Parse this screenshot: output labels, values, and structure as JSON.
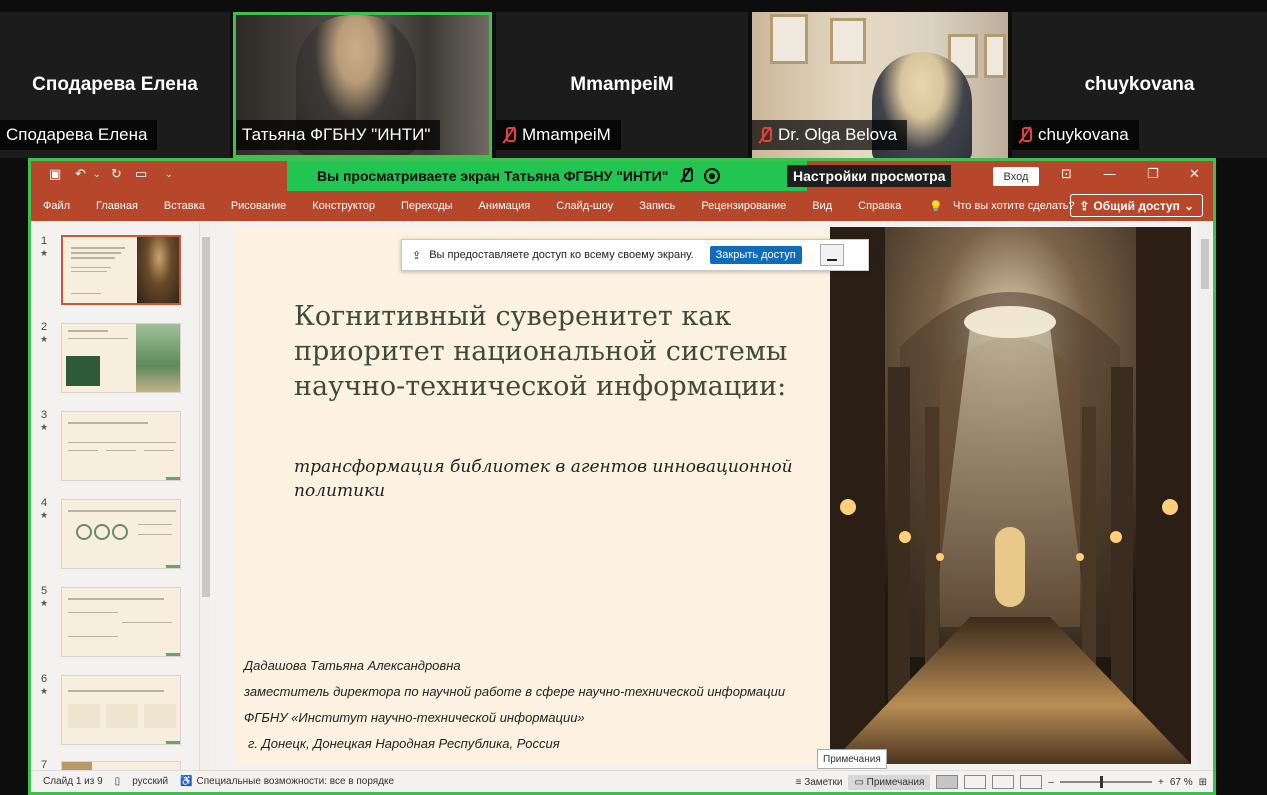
{
  "participants": [
    {
      "name": "Сподарева Елена",
      "label": "Сподарева Елена",
      "muted": false,
      "video": false
    },
    {
      "name": "Татьяна ФГБНУ \"ИНТИ\"",
      "label": "Татьяна ФГБНУ \"ИНТИ\"",
      "muted": false,
      "video": true,
      "active": true
    },
    {
      "name": "MmampeiM",
      "label": "MmampeiM",
      "muted": true,
      "video": false
    },
    {
      "name": "Dr. Olga Belova",
      "label": "Dr. Olga Belova",
      "muted": true,
      "video": true
    },
    {
      "name": "chuykovana",
      "label": "chuykovana",
      "muted": true,
      "video": false
    }
  ],
  "share_banner": {
    "text": "Вы просматриваете экран  Татьяна ФГБНУ \"ИНТИ\"",
    "view_settings": "Настройки просмотра"
  },
  "app": {
    "accent": "#b7472a",
    "login_label": "Вход",
    "ribbon_tabs": [
      "Файл",
      "Главная",
      "Вставка",
      "Рисование",
      "Конструктор",
      "Переходы",
      "Анимация",
      "Слайд-шоу",
      "Запись",
      "Рецензирование",
      "Вид",
      "Справка"
    ],
    "search_placeholder": "Что вы хотите сделать?",
    "share_label": "Общий доступ"
  },
  "sharing_bar": {
    "message": "Вы предоставляете доступ ко всему своему экрану.",
    "close_label": "Закрыть доступ"
  },
  "thumbnails": [
    {
      "num": "1"
    },
    {
      "num": "2"
    },
    {
      "num": "3"
    },
    {
      "num": "4"
    },
    {
      "num": "5"
    },
    {
      "num": "6"
    },
    {
      "num": "7"
    }
  ],
  "slide": {
    "title": "Когнитивный суверенитет как приоритет национальной системы научно-технической информации:",
    "subtitle": "трансформация библиотек в агентов инновационной политики",
    "author_name": "Дадашова Татьяна Александровна",
    "author_position": "заместитель директора по научной работе в сфере научно-технической информации",
    "author_org": "ФГБНУ «Институт научно-технической информации»",
    "author_city": "г. Донецк, Донецкая Народная Республика, Россия"
  },
  "tooltip": "Примечания",
  "status": {
    "slide_counter": "Слайд 1 из 9",
    "language": "русский",
    "accessibility": "Специальные возможности: все в порядке",
    "notes": "Заметки",
    "comments": "Примечания",
    "zoom": "67 %"
  }
}
